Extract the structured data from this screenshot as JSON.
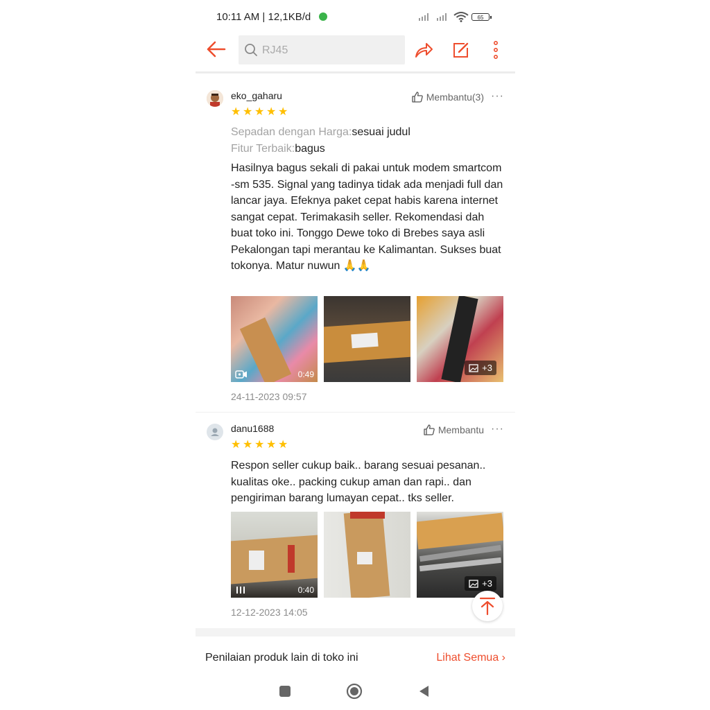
{
  "status_bar": {
    "time": "10:11 AM | 12,1KB/d",
    "battery": "65"
  },
  "search": {
    "placeholder": "RJ45"
  },
  "reviews": [
    {
      "username": "eko_gaharu",
      "rating": 5,
      "helpful": "Membantu(3)",
      "more": "···",
      "attrs": [
        {
          "key": "Sepadan dengan Harga:",
          "value": "sesuai judul"
        },
        {
          "key": "Fitur Terbaik:",
          "value": "bagus"
        }
      ],
      "text": "Hasilnya bagus sekali di pakai untuk modem smartcom -sm 535. Signal yang tadinya tidak ada menjadi full dan lancar jaya. Efeknya paket cepat habis karena internet sangat cepat. Terimakasih seller. Rekomendasi dah buat toko ini. Tonggo Dewe toko di Brebes saya asli Pekalongan tapi merantau ke Kalimantan. Sukses buat tokonya. Matur nuwun 🙏🙏",
      "video_duration": "0:49",
      "more_photos": "+3",
      "date": "24-11-2023 09:57"
    },
    {
      "username": "danu1688",
      "rating": 5,
      "helpful": "Membantu",
      "more": "···",
      "text": "Respon seller cukup baik.. barang sesuai pesanan.. kualitas oke.. packing cukup aman dan rapi.. dan pengiriman barang lumayan cepat.. tks seller.",
      "video_duration": "0:40",
      "more_photos": "+3",
      "date": "12-12-2023 14:05"
    }
  ],
  "footer": {
    "title": "Penilaian produk lain di toko ini",
    "link": "Lihat Semua"
  },
  "colors": {
    "accent": "#ee4d2d",
    "star": "#ffbf00"
  }
}
